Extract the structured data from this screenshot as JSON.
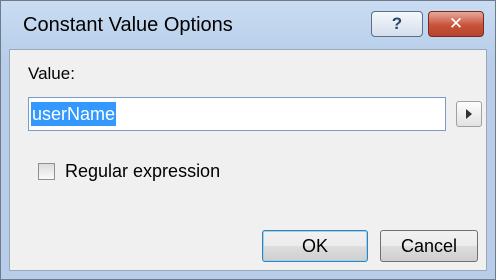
{
  "window": {
    "title": "Constant Value Options",
    "help_glyph": "?",
    "close_glyph": "✕"
  },
  "form": {
    "value_label": "Value:",
    "value_text": "userName",
    "value_selected": true,
    "regex_label": "Regular expression",
    "regex_checked": false
  },
  "buttons": {
    "ok_label": "OK",
    "cancel_label": "Cancel"
  },
  "icons": {
    "help": "help-icon",
    "close": "close-icon",
    "arrow": "arrow-right-icon"
  }
}
